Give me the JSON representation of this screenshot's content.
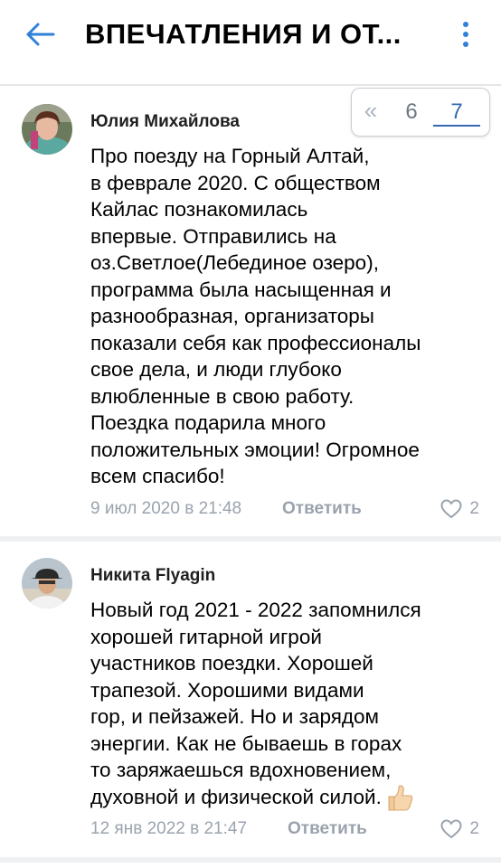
{
  "header": {
    "title": "ВПЕЧАТЛЕНИЯ И ОТ...",
    "back_icon": "arrow-left-icon",
    "menu_icon": "vertical-dots-icon",
    "accent_color": "#2f80d9"
  },
  "pagination": {
    "prev": "«",
    "pages": [
      "6",
      "7"
    ],
    "current": "7"
  },
  "comments": [
    {
      "author": "Юлия Михайлова",
      "text_lines": [
        "Про поезду на Горный Алтай,",
        "в феврале 2020. С обществом",
        "Кайлас познакомилась",
        "впервые. Отправились на",
        "оз.Светлое(Лебединое озеро),",
        "программа была насыщенная и",
        "разнообразная, организаторы",
        "показали себя как профессионалы",
        "свое дела, и люди глубоко",
        "влюбленные в свою работу.",
        "Поездка подарила много",
        "положительных эмоции! Огромное",
        "всем спасибо!"
      ],
      "date": "9 июл 2020 в 21:48",
      "reply_label": "Ответить",
      "likes": "2"
    },
    {
      "author": "Никита Flyagin",
      "text_lines": [
        "Новый год 2021 - 2022 запомнился",
        "хорошей гитарной игрой",
        "участников поездки. Хорошей",
        "трапезой. Хорошими видами",
        "гор, и пейзажей. Но и зарядом",
        "энергии. Как не бываешь в горах",
        "то заряжаешься вдохновением,",
        "духовной и физической силой."
      ],
      "emoji": "thumbs-up-icon",
      "date": "12 янв 2022 в 21:47",
      "reply_label": "Ответить",
      "likes": "2"
    }
  ]
}
